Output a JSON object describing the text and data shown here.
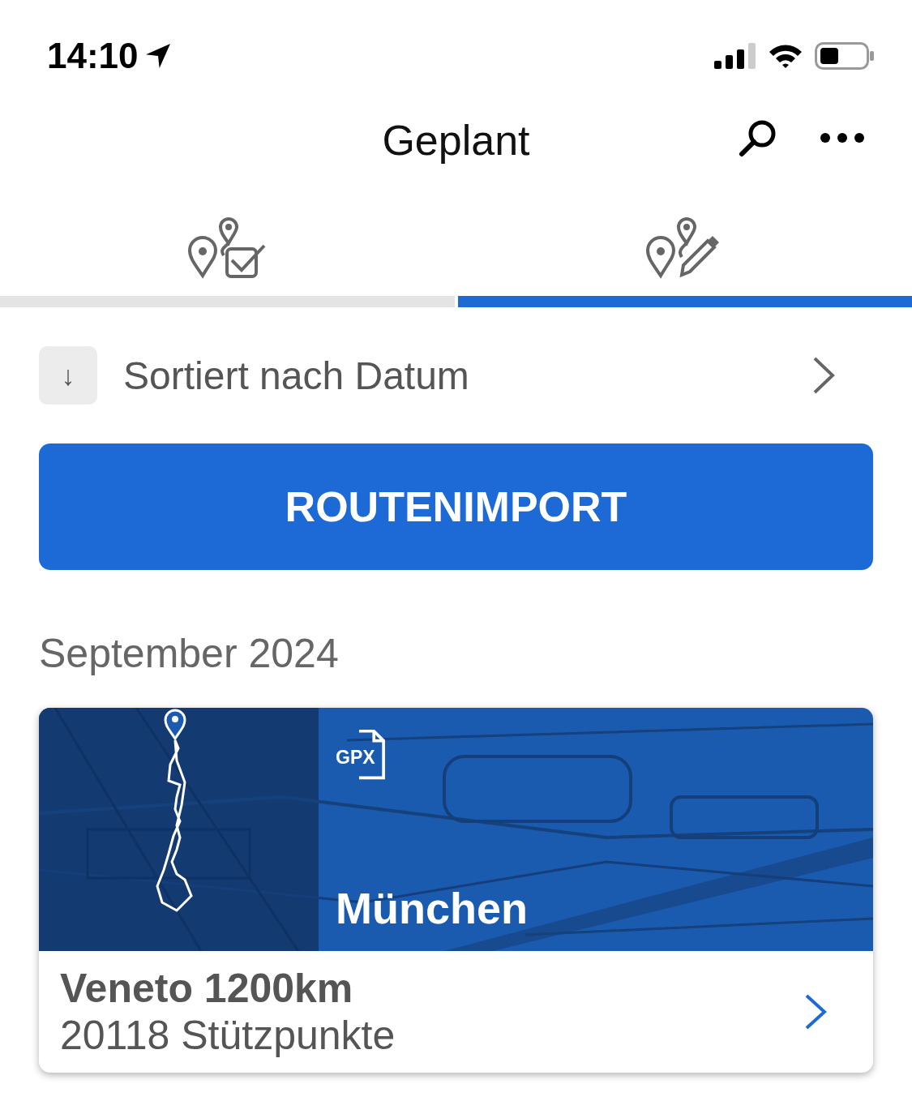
{
  "status_bar": {
    "time": "14:10"
  },
  "header": {
    "title": "Geplant"
  },
  "tabs": [
    {
      "kind": "done",
      "selected": false
    },
    {
      "kind": "planned",
      "selected": true
    }
  ],
  "sort": {
    "arrow": "↓",
    "label": "Sortiert nach Datum"
  },
  "import_button": "ROUTENIMPORT",
  "sections": [
    {
      "heading": "September 2024",
      "routes": [
        {
          "file_badge": "GPX",
          "start": "München",
          "title": "Veneto 1200km",
          "subtitle": "20118 Stützpunkte"
        }
      ]
    }
  ]
}
